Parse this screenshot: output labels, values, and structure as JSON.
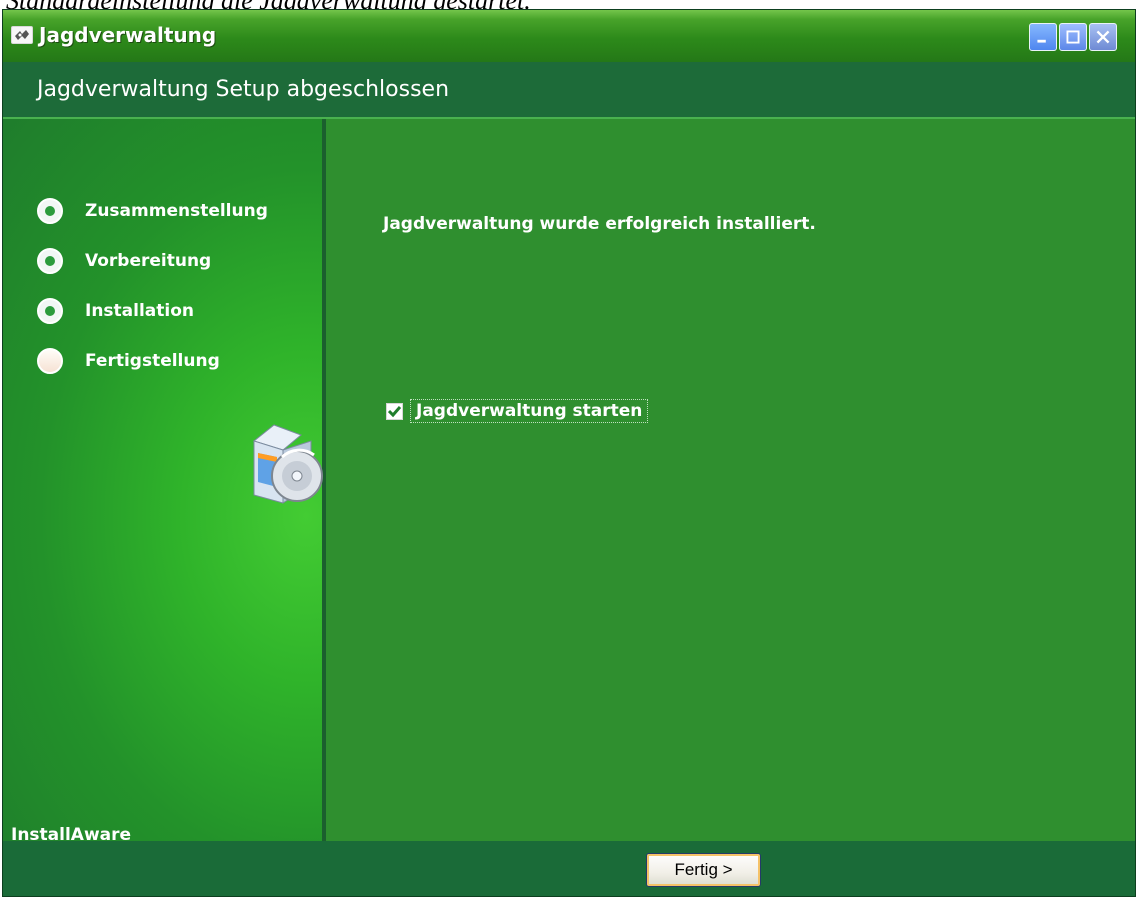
{
  "document": {
    "caption": "Standardeinstellung die Jagdverwaltung gestartet."
  },
  "window": {
    "title": "Jagdverwaltung"
  },
  "header": {
    "title": "Jagdverwaltung Setup abgeschlossen"
  },
  "steps": [
    {
      "label": "Zusammenstellung",
      "status": "done"
    },
    {
      "label": "Vorbereitung",
      "status": "done"
    },
    {
      "label": "Installation",
      "status": "done"
    },
    {
      "label": "Fertigstellung",
      "status": "current"
    }
  ],
  "main": {
    "message": "Jagdverwaltung wurde erfolgreich installiert.",
    "checkbox": {
      "label": "Jagdverwaltung starten",
      "checked": true
    }
  },
  "left_panel": {
    "brand": "InstallAware"
  },
  "footer": {
    "finish_label": "Fertig >"
  },
  "icons": {
    "app": "app-icon",
    "setup": "setup-box-icon",
    "check": "checkmark-icon"
  },
  "colors": {
    "title_bar": "#2d8a1a",
    "header_strip": "#1d6b39",
    "left_panel": "#2fb32a",
    "main_panel": "#2f8f2f",
    "footer": "#1a6b38"
  }
}
